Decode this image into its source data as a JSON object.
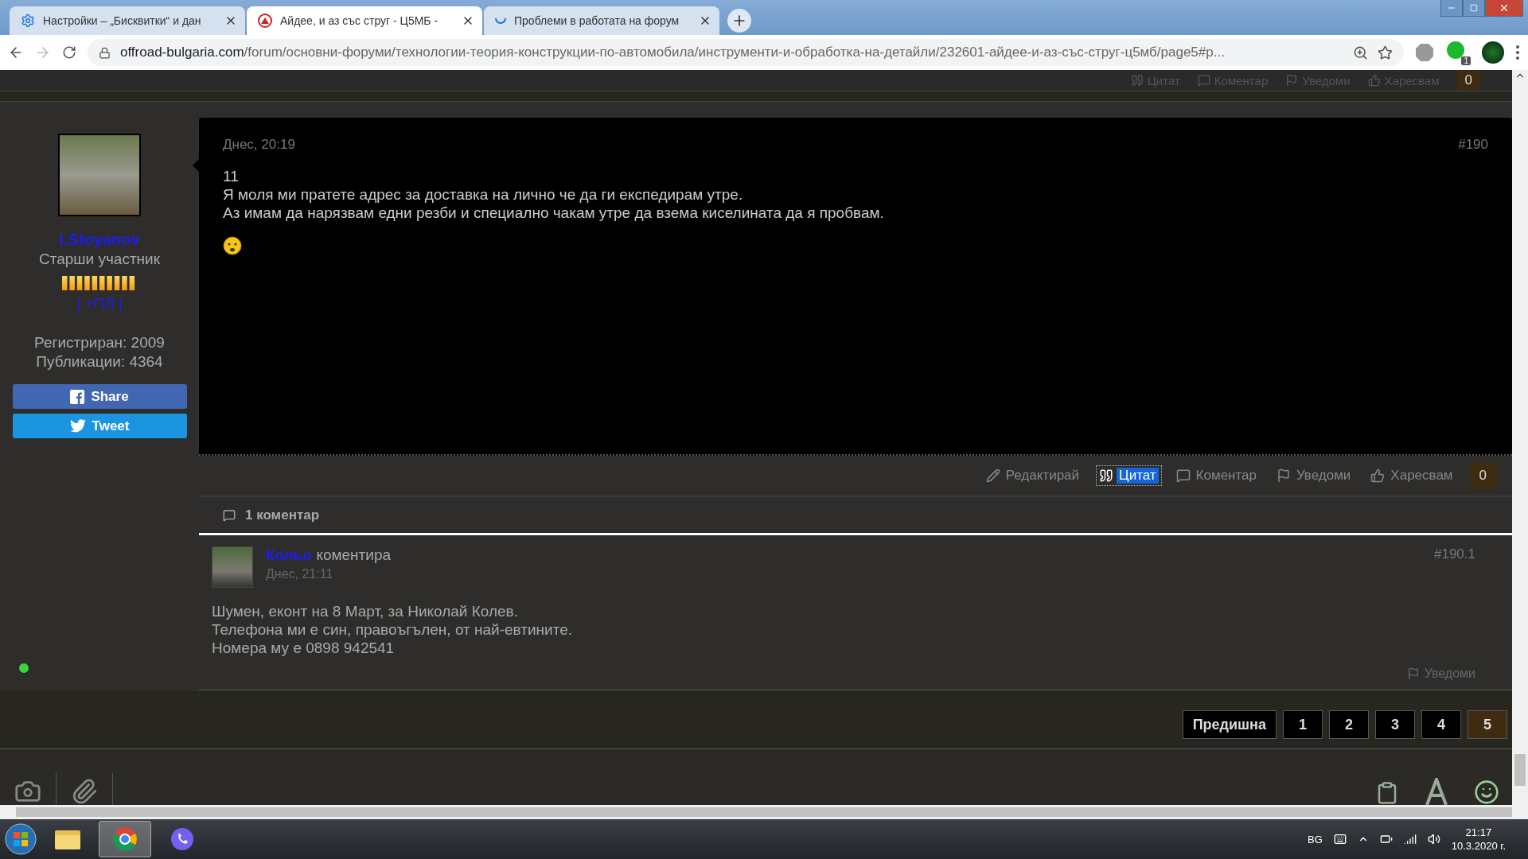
{
  "browser": {
    "tabs": [
      {
        "title": "Настройки – „Бисквитки“ и дан",
        "selected": false,
        "kind": "settings"
      },
      {
        "title": "Айдее, и аз със струг - Ц5МБ -",
        "selected": true,
        "kind": "site"
      },
      {
        "title": "Проблеми в работата на форум",
        "selected": false,
        "kind": "loading"
      }
    ],
    "url_host": "offroad-bulgaria.com",
    "url_path": "/forum/основни-форуми/технологии-теория-конструкции-по-автомобила/инструменти-и-обработка-на-детайли/232601-айдее-и-аз-със-струг-ц5мб/page5#p...",
    "extension_badge": "1"
  },
  "previous_post_actions": [
    {
      "label": "Цитат",
      "kind": "quote"
    },
    {
      "label": "Коментар",
      "kind": "comment"
    },
    {
      "label": "Уведоми",
      "kind": "flag"
    },
    {
      "label": "Харесвам",
      "kind": "like"
    }
  ],
  "previous_post_likes": "0",
  "author": {
    "name": "I.Stoyanov",
    "rank": "Старши участник",
    "links": "| +ПЛ |",
    "registered": "Регистриран: 2009",
    "posts": "Публикации: 4364",
    "online": true
  },
  "share_buttons": [
    {
      "label": "Share",
      "kind": "facebook"
    },
    {
      "label": "Tweet",
      "kind": "twitter"
    }
  ],
  "post": {
    "date": "Днес, 20:19",
    "number": "#190",
    "lines": [
      "11",
      "Я моля ми пратете адрес за доставка на лично че да ги експедирам утре.",
      "Аз имам да нарязвам едни резби и специално чакам утре да взема киселината да я пробвам."
    ]
  },
  "post_actions": [
    {
      "label": "Редактирай",
      "kind": "edit",
      "highlighted": false
    },
    {
      "label": "Цитат",
      "kind": "quote",
      "highlighted": true
    },
    {
      "label": "Коментар",
      "kind": "comment",
      "highlighted": false
    },
    {
      "label": "Уведоми",
      "kind": "flag",
      "highlighted": false
    },
    {
      "label": "Харесвам",
      "kind": "like",
      "highlighted": false
    }
  ],
  "likes": "0",
  "comments_header": "1 коментар",
  "comment": {
    "author": "Кольо",
    "verb": "коментира",
    "date": "Днес, 21:11",
    "number": "#190.1",
    "lines": [
      "Шумен, еконт на 8 Март, за Николай Колев.",
      "Телефона ми е син, правоъгълен, от най-евтините.",
      "Номера му е 0898 942541"
    ],
    "report": "Уведоми"
  },
  "pagination": [
    {
      "label": "Предишна",
      "selected": false
    },
    {
      "label": "1",
      "selected": false
    },
    {
      "label": "2",
      "selected": false
    },
    {
      "label": "3",
      "selected": false
    },
    {
      "label": "4",
      "selected": false
    },
    {
      "label": "5",
      "selected": true
    }
  ],
  "taskbar": {
    "apps": [
      {
        "kind": "explorer",
        "selected": false
      },
      {
        "kind": "chrome",
        "selected": true
      },
      {
        "kind": "viber",
        "selected": false
      }
    ],
    "language": "BG",
    "time": "21:17",
    "date": "10.3.2020 г."
  }
}
